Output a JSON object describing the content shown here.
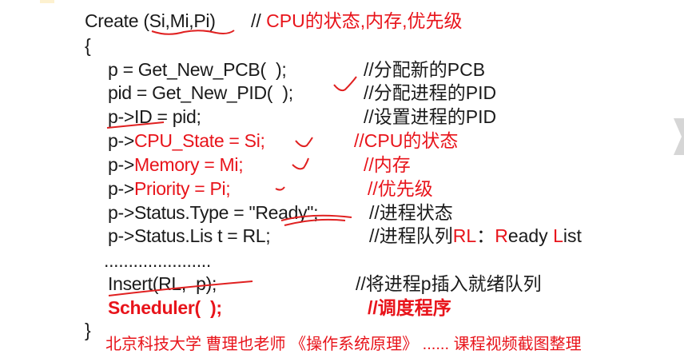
{
  "lines": [
    {
      "code": [
        {
          "t": "Create (Si,Mi,Pi)"
        }
      ],
      "comment": [
        {
          "t": "// "
        },
        {
          "t": "CPU的状态,内存,优先级",
          "red": true
        }
      ]
    },
    {
      "code": [
        {
          "t": "{"
        }
      ],
      "comment": []
    },
    {
      "code": [
        {
          "t": "p = Get_New_PCB(  );"
        }
      ],
      "comment": [
        {
          "t": "//分配新的PCB"
        }
      ]
    },
    {
      "code": [
        {
          "t": "pid = Get_New_PID(  );"
        }
      ],
      "comment": [
        {
          "t": "//分配进程的PID"
        }
      ]
    },
    {
      "code": [
        {
          "t": "p->ID = pid;"
        }
      ],
      "comment": [
        {
          "t": "//设置进程的PID"
        }
      ]
    },
    {
      "code": [
        {
          "t": "p->"
        },
        {
          "t": "CPU_State = Si;",
          "red": true
        }
      ],
      "comment": [
        {
          "t": "//CPU的状态",
          "red": true
        }
      ]
    },
    {
      "code": [
        {
          "t": "p->"
        },
        {
          "t": "Memory = Mi;",
          "red": true
        }
      ],
      "comment": [
        {
          "t": "//内存",
          "red": true
        }
      ]
    },
    {
      "code": [
        {
          "t": "p->"
        },
        {
          "t": "Priority = Pi;",
          "red": true
        }
      ],
      "comment": [
        {
          "t": "//优先级",
          "red": true
        }
      ]
    },
    {
      "code": [
        {
          "t": "p->Status.Type = \"Ready\";"
        }
      ],
      "comment": [
        {
          "t": "//进程状态"
        }
      ]
    },
    {
      "code": [
        {
          "t": "p->Status.Lis t = RL;"
        }
      ],
      "comment": [
        {
          "t": "//进程队列"
        },
        {
          "t": "RL",
          "red": true
        },
        {
          "t": "：",
          "red": false
        },
        {
          "t": "R",
          "red": true
        },
        {
          "t": "eady "
        },
        {
          "t": "L",
          "red": true
        },
        {
          "t": "ist"
        }
      ]
    },
    {
      "code": [
        {
          "t": "......................"
        }
      ],
      "comment": []
    },
    {
      "code": [
        {
          "t": "Insert(RL,  p);"
        }
      ],
      "comment": [
        {
          "t": "//将进程p插入就绪队列"
        }
      ]
    },
    {
      "code": [
        {
          "t": "Scheduler(  );",
          "red": true,
          "bold": true
        }
      ],
      "comment": [
        {
          "t": "//调度程序",
          "red": true,
          "bold": true
        }
      ]
    },
    {
      "code": [
        {
          "t": "}"
        }
      ],
      "comment": []
    }
  ],
  "footer": "北京科技大学 曹理也老师 《操作系统原理》 ...... 课程视频截图整理",
  "icons": {
    "next": "chevron-right-icon"
  },
  "colors": {
    "red": "#e8141b",
    "text": "#1a1a1a",
    "annotation": "#e02020"
  }
}
